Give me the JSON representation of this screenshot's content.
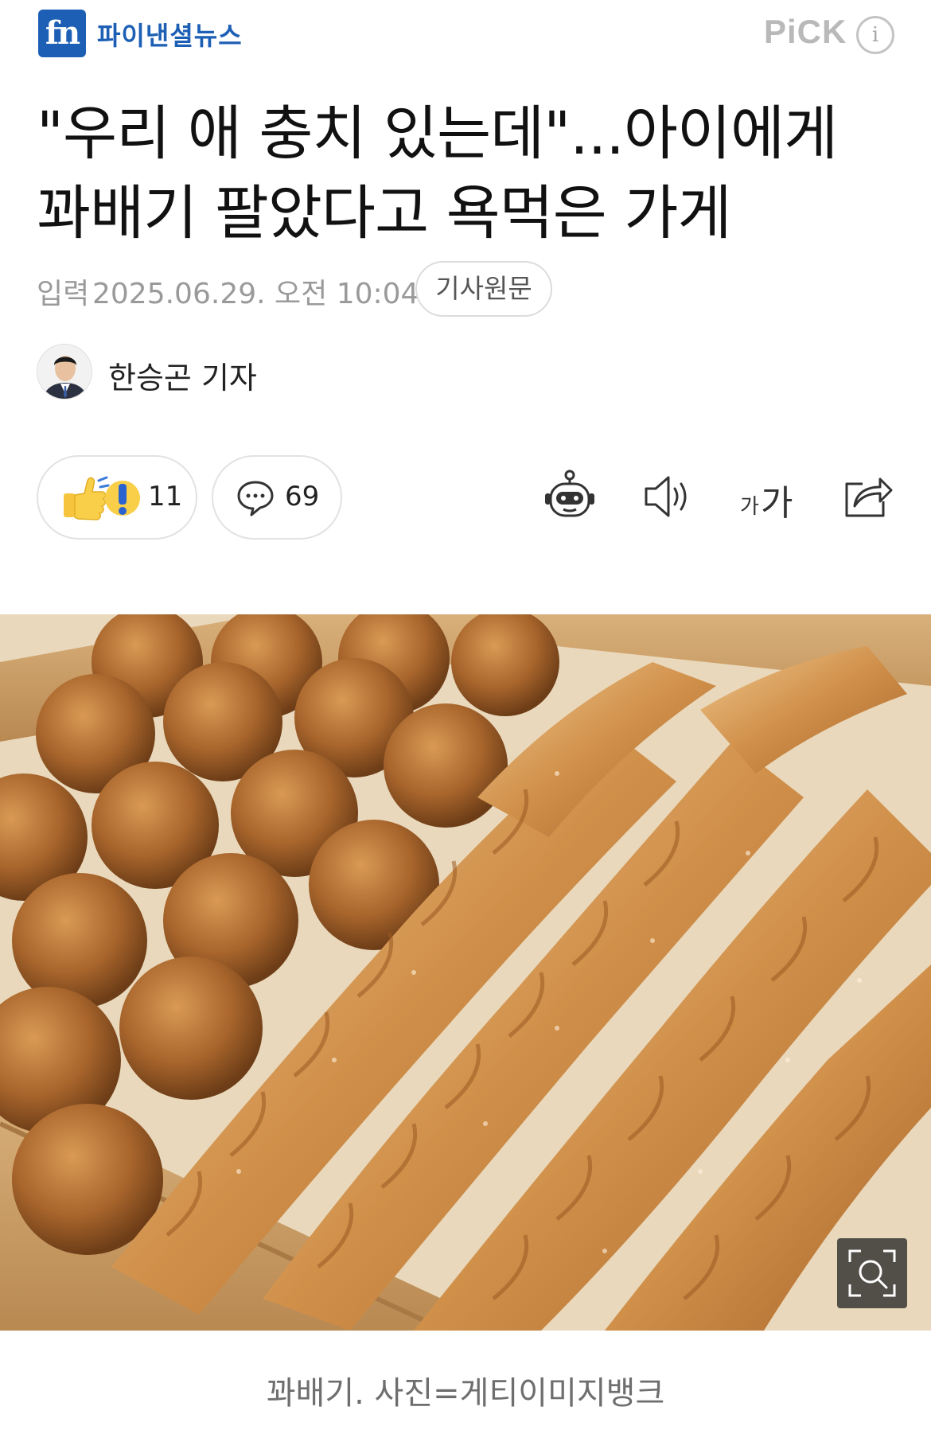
{
  "header": {
    "logo_mark": "fn",
    "logo_text": "파이낸셜뉴스",
    "pick_label": "PiCK",
    "info_label": "i"
  },
  "article": {
    "title": "\"우리 애 충치 있는데\"...아이에게 꽈배기 팔았다고 욕먹은 가게",
    "date_label": "입력",
    "date_value": "2025.06.29. 오전 10:04",
    "original_button": "기사원문",
    "reporter": "한승곤 기자"
  },
  "actions": {
    "reaction_count": "11",
    "comment_count": "69",
    "tools": [
      "robot-summary-icon",
      "speaker-icon",
      "font-size-icon",
      "share-icon"
    ],
    "font_size_label": "가가"
  },
  "photo": {
    "caption": "꽈배기. 사진=게티이미지뱅크"
  },
  "colors": {
    "brand": "#1d5fb5",
    "muted_text": "#9a9a9a",
    "border": "#e2e2e2"
  }
}
